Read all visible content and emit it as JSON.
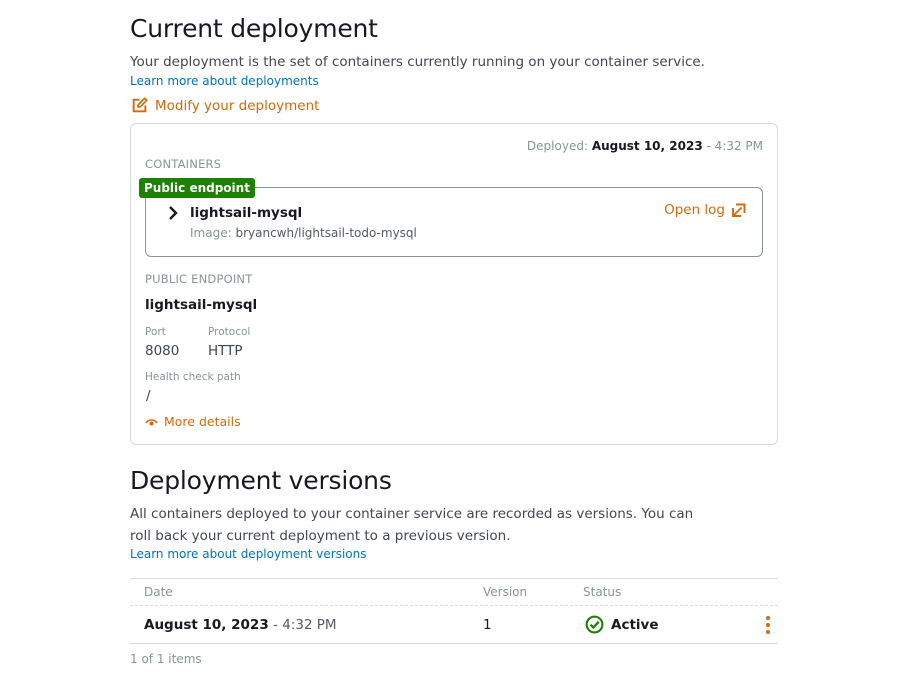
{
  "current": {
    "title": "Current deployment",
    "description": "Your deployment is the set of containers currently running on your container service.",
    "learn_more": "Learn more about deployments",
    "modify_label": "Modify your deployment",
    "modify_icon": "edit-icon"
  },
  "card": {
    "deployed_label": "Deployed:",
    "deployed_date": "August 10, 2023",
    "deployed_sep": " - ",
    "deployed_time": "4:32 PM",
    "containers_caption": "CONTAINERS",
    "badge": "Public endpoint",
    "container": {
      "name": "lightsail-mysql",
      "image_label": "Image:",
      "image_value": "bryancwh/lightsail-todo-mysql",
      "open_log": "Open log",
      "open_log_icon": "open-log-icon",
      "expand_icon": "chevron-right-icon"
    },
    "public_endpoint_caption": "PUBLIC ENDPOINT",
    "endpoint_name": "lightsail-mysql",
    "port_label": "Port",
    "port_value": "8080",
    "protocol_label": "Protocol",
    "protocol_value": "HTTP",
    "health_label": "Health check path",
    "health_value": "/",
    "more_details": "More details",
    "more_icon": "eye-icon"
  },
  "versions": {
    "title": "Deployment versions",
    "description_line1": "All containers deployed to your container service are recorded as versions. You can",
    "description_line2": "roll back your current deployment to a previous version.",
    "learn_more": "Learn more about deployment versions",
    "columns": {
      "date": "Date",
      "version": "Version",
      "status": "Status"
    },
    "rows": [
      {
        "date": "August 10, 2023",
        "sep": " - ",
        "time": "4:32 PM",
        "version": "1",
        "status": "Active",
        "status_icon": "check-circle-icon"
      }
    ],
    "count": "1 of 1 items"
  },
  "colors": {
    "accent": "#d4690b",
    "link": "#0073bb",
    "success": "#1d8102",
    "border": "#d5dbdb"
  }
}
